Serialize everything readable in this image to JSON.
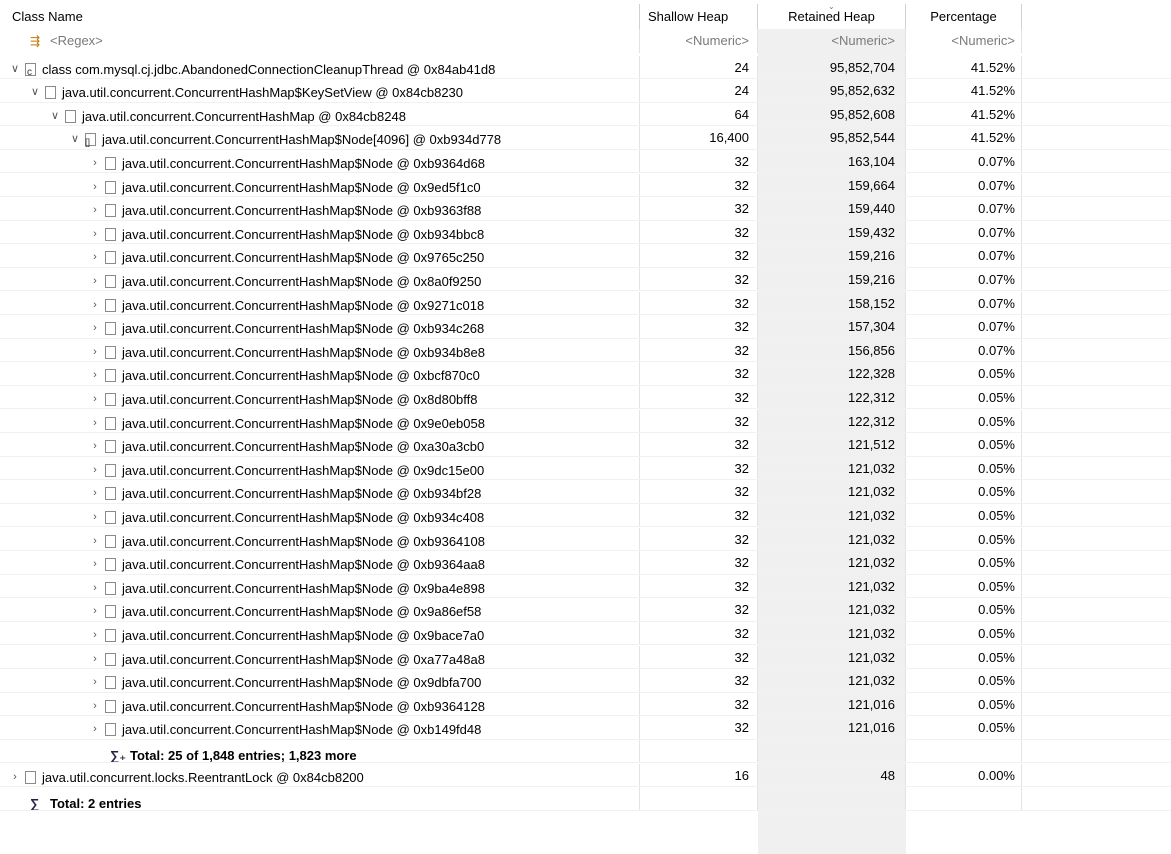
{
  "columns": {
    "class_name": "Class Name",
    "shallow_heap": "Shallow Heap",
    "retained_heap": "Retained Heap",
    "percentage": "Percentage"
  },
  "filters": {
    "class_name": "<Regex>",
    "shallow_heap": "<Numeric>",
    "retained_heap": "<Numeric>",
    "percentage": "<Numeric>"
  },
  "rows": [
    {
      "name": "class com.mysql.cj.jdbc.AbandonedConnectionCleanupThread @ 0x84ab41d8",
      "shallow": "24",
      "retained": "95,852,704",
      "pct": "41.52%",
      "indent": 0,
      "expanded": true,
      "icon": "class-icon"
    },
    {
      "name": "java.util.concurrent.ConcurrentHashMap$KeySetView @ 0x84cb8230",
      "shallow": "24",
      "retained": "95,852,632",
      "pct": "41.52%",
      "indent": 1,
      "expanded": true,
      "icon": "object-icon"
    },
    {
      "name": "java.util.concurrent.ConcurrentHashMap @ 0x84cb8248",
      "shallow": "64",
      "retained": "95,852,608",
      "pct": "41.52%",
      "indent": 2,
      "expanded": true,
      "icon": "object-icon"
    },
    {
      "name": "java.util.concurrent.ConcurrentHashMap$Node[4096] @ 0xb934d778",
      "shallow": "16,400",
      "retained": "95,852,544",
      "pct": "41.52%",
      "indent": 3,
      "expanded": true,
      "icon": "array-icon"
    },
    {
      "name": "java.util.concurrent.ConcurrentHashMap$Node @ 0xb9364d68",
      "shallow": "32",
      "retained": "163,104",
      "pct": "0.07%",
      "indent": 4,
      "expanded": false,
      "icon": "object-icon"
    },
    {
      "name": "java.util.concurrent.ConcurrentHashMap$Node @ 0x9ed5f1c0",
      "shallow": "32",
      "retained": "159,664",
      "pct": "0.07%",
      "indent": 4,
      "expanded": false,
      "icon": "object-icon"
    },
    {
      "name": "java.util.concurrent.ConcurrentHashMap$Node @ 0xb9363f88",
      "shallow": "32",
      "retained": "159,440",
      "pct": "0.07%",
      "indent": 4,
      "expanded": false,
      "icon": "object-icon"
    },
    {
      "name": "java.util.concurrent.ConcurrentHashMap$Node @ 0xb934bbc8",
      "shallow": "32",
      "retained": "159,432",
      "pct": "0.07%",
      "indent": 4,
      "expanded": false,
      "icon": "object-icon"
    },
    {
      "name": "java.util.concurrent.ConcurrentHashMap$Node @ 0x9765c250",
      "shallow": "32",
      "retained": "159,216",
      "pct": "0.07%",
      "indent": 4,
      "expanded": false,
      "icon": "object-icon"
    },
    {
      "name": "java.util.concurrent.ConcurrentHashMap$Node @ 0x8a0f9250",
      "shallow": "32",
      "retained": "159,216",
      "pct": "0.07%",
      "indent": 4,
      "expanded": false,
      "icon": "object-icon"
    },
    {
      "name": "java.util.concurrent.ConcurrentHashMap$Node @ 0x9271c018",
      "shallow": "32",
      "retained": "158,152",
      "pct": "0.07%",
      "indent": 4,
      "expanded": false,
      "icon": "object-icon"
    },
    {
      "name": "java.util.concurrent.ConcurrentHashMap$Node @ 0xb934c268",
      "shallow": "32",
      "retained": "157,304",
      "pct": "0.07%",
      "indent": 4,
      "expanded": false,
      "icon": "object-icon"
    },
    {
      "name": "java.util.concurrent.ConcurrentHashMap$Node @ 0xb934b8e8",
      "shallow": "32",
      "retained": "156,856",
      "pct": "0.07%",
      "indent": 4,
      "expanded": false,
      "icon": "object-icon"
    },
    {
      "name": "java.util.concurrent.ConcurrentHashMap$Node @ 0xbcf870c0",
      "shallow": "32",
      "retained": "122,328",
      "pct": "0.05%",
      "indent": 4,
      "expanded": false,
      "icon": "object-icon"
    },
    {
      "name": "java.util.concurrent.ConcurrentHashMap$Node @ 0x8d80bff8",
      "shallow": "32",
      "retained": "122,312",
      "pct": "0.05%",
      "indent": 4,
      "expanded": false,
      "icon": "object-icon"
    },
    {
      "name": "java.util.concurrent.ConcurrentHashMap$Node @ 0x9e0eb058",
      "shallow": "32",
      "retained": "122,312",
      "pct": "0.05%",
      "indent": 4,
      "expanded": false,
      "icon": "object-icon"
    },
    {
      "name": "java.util.concurrent.ConcurrentHashMap$Node @ 0xa30a3cb0",
      "shallow": "32",
      "retained": "121,512",
      "pct": "0.05%",
      "indent": 4,
      "expanded": false,
      "icon": "object-icon"
    },
    {
      "name": "java.util.concurrent.ConcurrentHashMap$Node @ 0x9dc15e00",
      "shallow": "32",
      "retained": "121,032",
      "pct": "0.05%",
      "indent": 4,
      "expanded": false,
      "icon": "object-icon"
    },
    {
      "name": "java.util.concurrent.ConcurrentHashMap$Node @ 0xb934bf28",
      "shallow": "32",
      "retained": "121,032",
      "pct": "0.05%",
      "indent": 4,
      "expanded": false,
      "icon": "object-icon"
    },
    {
      "name": "java.util.concurrent.ConcurrentHashMap$Node @ 0xb934c408",
      "shallow": "32",
      "retained": "121,032",
      "pct": "0.05%",
      "indent": 4,
      "expanded": false,
      "icon": "object-icon"
    },
    {
      "name": "java.util.concurrent.ConcurrentHashMap$Node @ 0xb9364108",
      "shallow": "32",
      "retained": "121,032",
      "pct": "0.05%",
      "indent": 4,
      "expanded": false,
      "icon": "object-icon"
    },
    {
      "name": "java.util.concurrent.ConcurrentHashMap$Node @ 0xb9364aa8",
      "shallow": "32",
      "retained": "121,032",
      "pct": "0.05%",
      "indent": 4,
      "expanded": false,
      "icon": "object-icon"
    },
    {
      "name": "java.util.concurrent.ConcurrentHashMap$Node @ 0x9ba4e898",
      "shallow": "32",
      "retained": "121,032",
      "pct": "0.05%",
      "indent": 4,
      "expanded": false,
      "icon": "object-icon"
    },
    {
      "name": "java.util.concurrent.ConcurrentHashMap$Node @ 0x9a86ef58",
      "shallow": "32",
      "retained": "121,032",
      "pct": "0.05%",
      "indent": 4,
      "expanded": false,
      "icon": "object-icon"
    },
    {
      "name": "java.util.concurrent.ConcurrentHashMap$Node @ 0x9bace7a0",
      "shallow": "32",
      "retained": "121,032",
      "pct": "0.05%",
      "indent": 4,
      "expanded": false,
      "icon": "object-icon"
    },
    {
      "name": "java.util.concurrent.ConcurrentHashMap$Node @ 0xa77a48a8",
      "shallow": "32",
      "retained": "121,032",
      "pct": "0.05%",
      "indent": 4,
      "expanded": false,
      "icon": "object-icon"
    },
    {
      "name": "java.util.concurrent.ConcurrentHashMap$Node @ 0x9dbfa700",
      "shallow": "32",
      "retained": "121,032",
      "pct": "0.05%",
      "indent": 4,
      "expanded": false,
      "icon": "object-icon"
    },
    {
      "name": "java.util.concurrent.ConcurrentHashMap$Node @ 0xb9364128",
      "shallow": "32",
      "retained": "121,016",
      "pct": "0.05%",
      "indent": 4,
      "expanded": false,
      "icon": "object-icon"
    },
    {
      "name": "java.util.concurrent.ConcurrentHashMap$Node @ 0xb149fd48",
      "shallow": "32",
      "retained": "121,016",
      "pct": "0.05%",
      "indent": 4,
      "expanded": false,
      "icon": "object-icon"
    },
    {
      "total": true,
      "name": "Total: 25 of 1,848 entries; 1,823 more",
      "indent": 4,
      "icon": "sigma-plus-icon"
    },
    {
      "name": "java.util.concurrent.locks.ReentrantLock @ 0x84cb8200",
      "shallow": "16",
      "retained": "48",
      "pct": "0.00%",
      "indent": 0,
      "expanded": false,
      "icon": "object-icon"
    },
    {
      "total": true,
      "name": "Total: 2 entries",
      "indent": 0,
      "icon": "sigma-icon"
    }
  ]
}
